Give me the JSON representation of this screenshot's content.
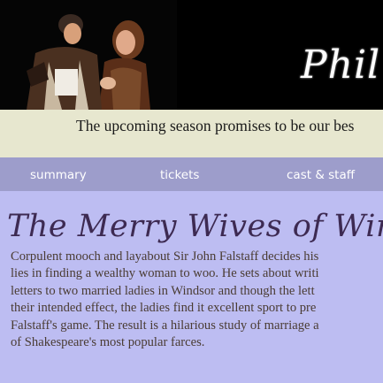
{
  "banner": {
    "title": "Phil",
    "photo_alt": "cast-photo"
  },
  "tagline": "The upcoming season promises to be our bes",
  "nav": {
    "summary": "summary",
    "tickets": "tickets",
    "cast_staff": "cast & staff"
  },
  "show": {
    "title": "The Merry Wives of Windsor",
    "description_lines": [
      "Corpulent mooch and layabout Sir John Falstaff decides his",
      "lies in finding a wealthy woman to woo. He sets about writi",
      "letters to two married ladies in Windsor and though the lett",
      "their intended effect, the ladies find it excellent sport to pre",
      "Falstaff's game. The result is a hilarious study of marriage a",
      "of Shakespeare's most popular farces."
    ]
  },
  "colors": {
    "banner_bg": "#000000",
    "tagline_bg": "#e7e7cf",
    "nav_bg": "#9d9dcb",
    "content_bg": "#bdbdf2",
    "title_color": "#3d2a52",
    "body_text": "#4a3c33"
  }
}
